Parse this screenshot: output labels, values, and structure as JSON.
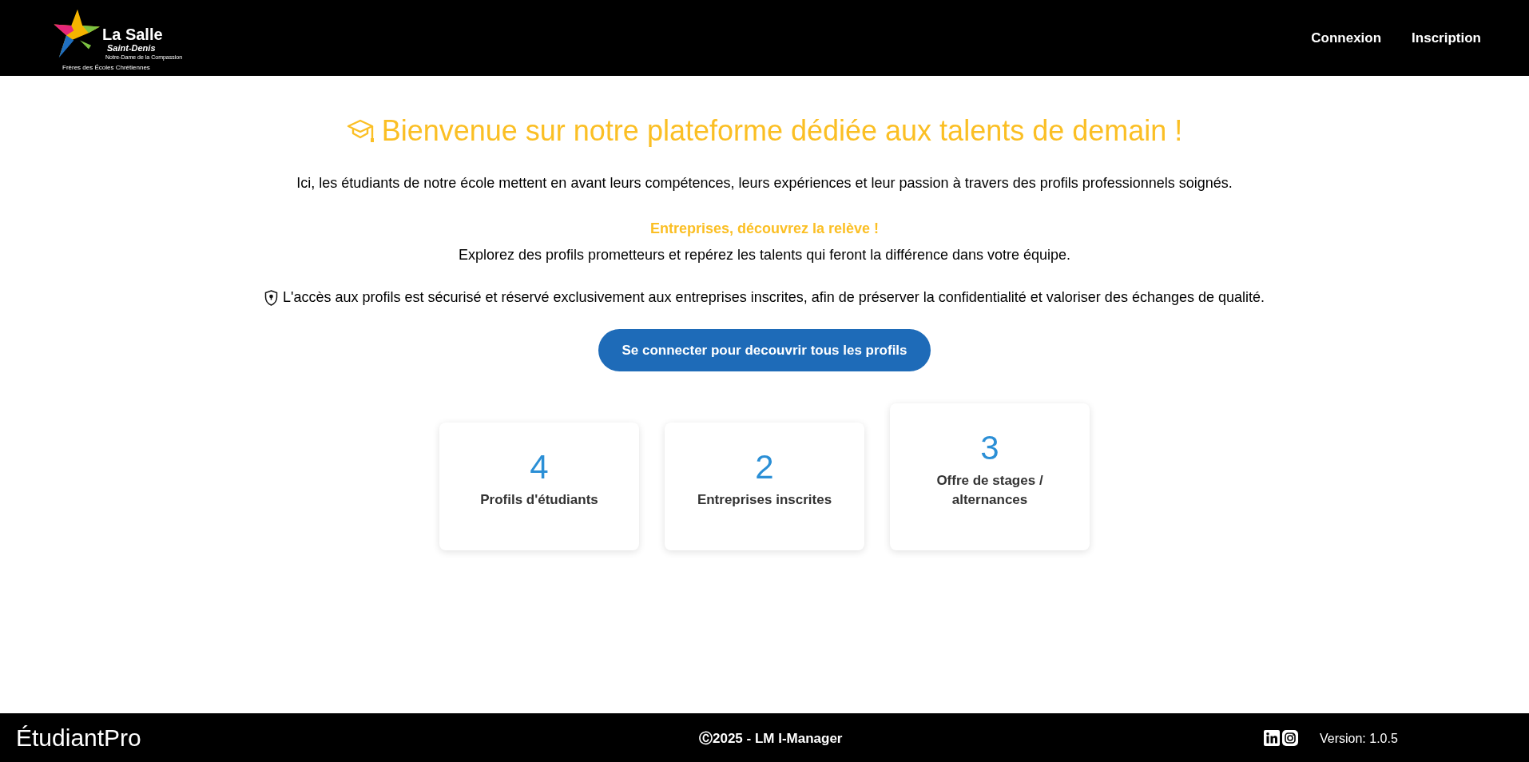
{
  "header": {
    "logo": {
      "name": "La Salle",
      "place": "Saint-Denis",
      "subtitle": "Notre-Dame de la Compassion",
      "motto": "Frères des Écoles Chrétiennes"
    },
    "nav": [
      {
        "label": "Connexion"
      },
      {
        "label": "Inscription"
      }
    ]
  },
  "hero": {
    "title": "Bienvenue sur notre plateforme dédiée aux talents de demain !",
    "intro": "Ici, les étudiants de notre école mettent en avant leurs compétences, leurs expériences et leur passion à travers des profils professionnels soignés.",
    "highlight": "Entreprises, découvrez la relève !",
    "explore": "Explorez des profils prometteurs et repérez les talents qui feront la différence dans votre équipe.",
    "security_note": "L'accès aux profils est sécurisé et réservé exclusivement aux entreprises inscrites, afin de préserver la confidentialité et valoriser des échanges de qualité.",
    "cta": "Se connecter pour decouvrir tous les profils"
  },
  "stats": [
    {
      "value": "4",
      "label": "Profils d'étudiants",
      "raised": false
    },
    {
      "value": "2",
      "label": "Entreprises inscrites",
      "raised": false
    },
    {
      "value": "3",
      "label": "Offre de stages / alternances",
      "raised": true
    }
  ],
  "footer": {
    "brand": "ÉtudiantPro",
    "copyright": "Ⓒ2025 - LM I-Manager",
    "version": "Version: 1.0.5"
  }
}
